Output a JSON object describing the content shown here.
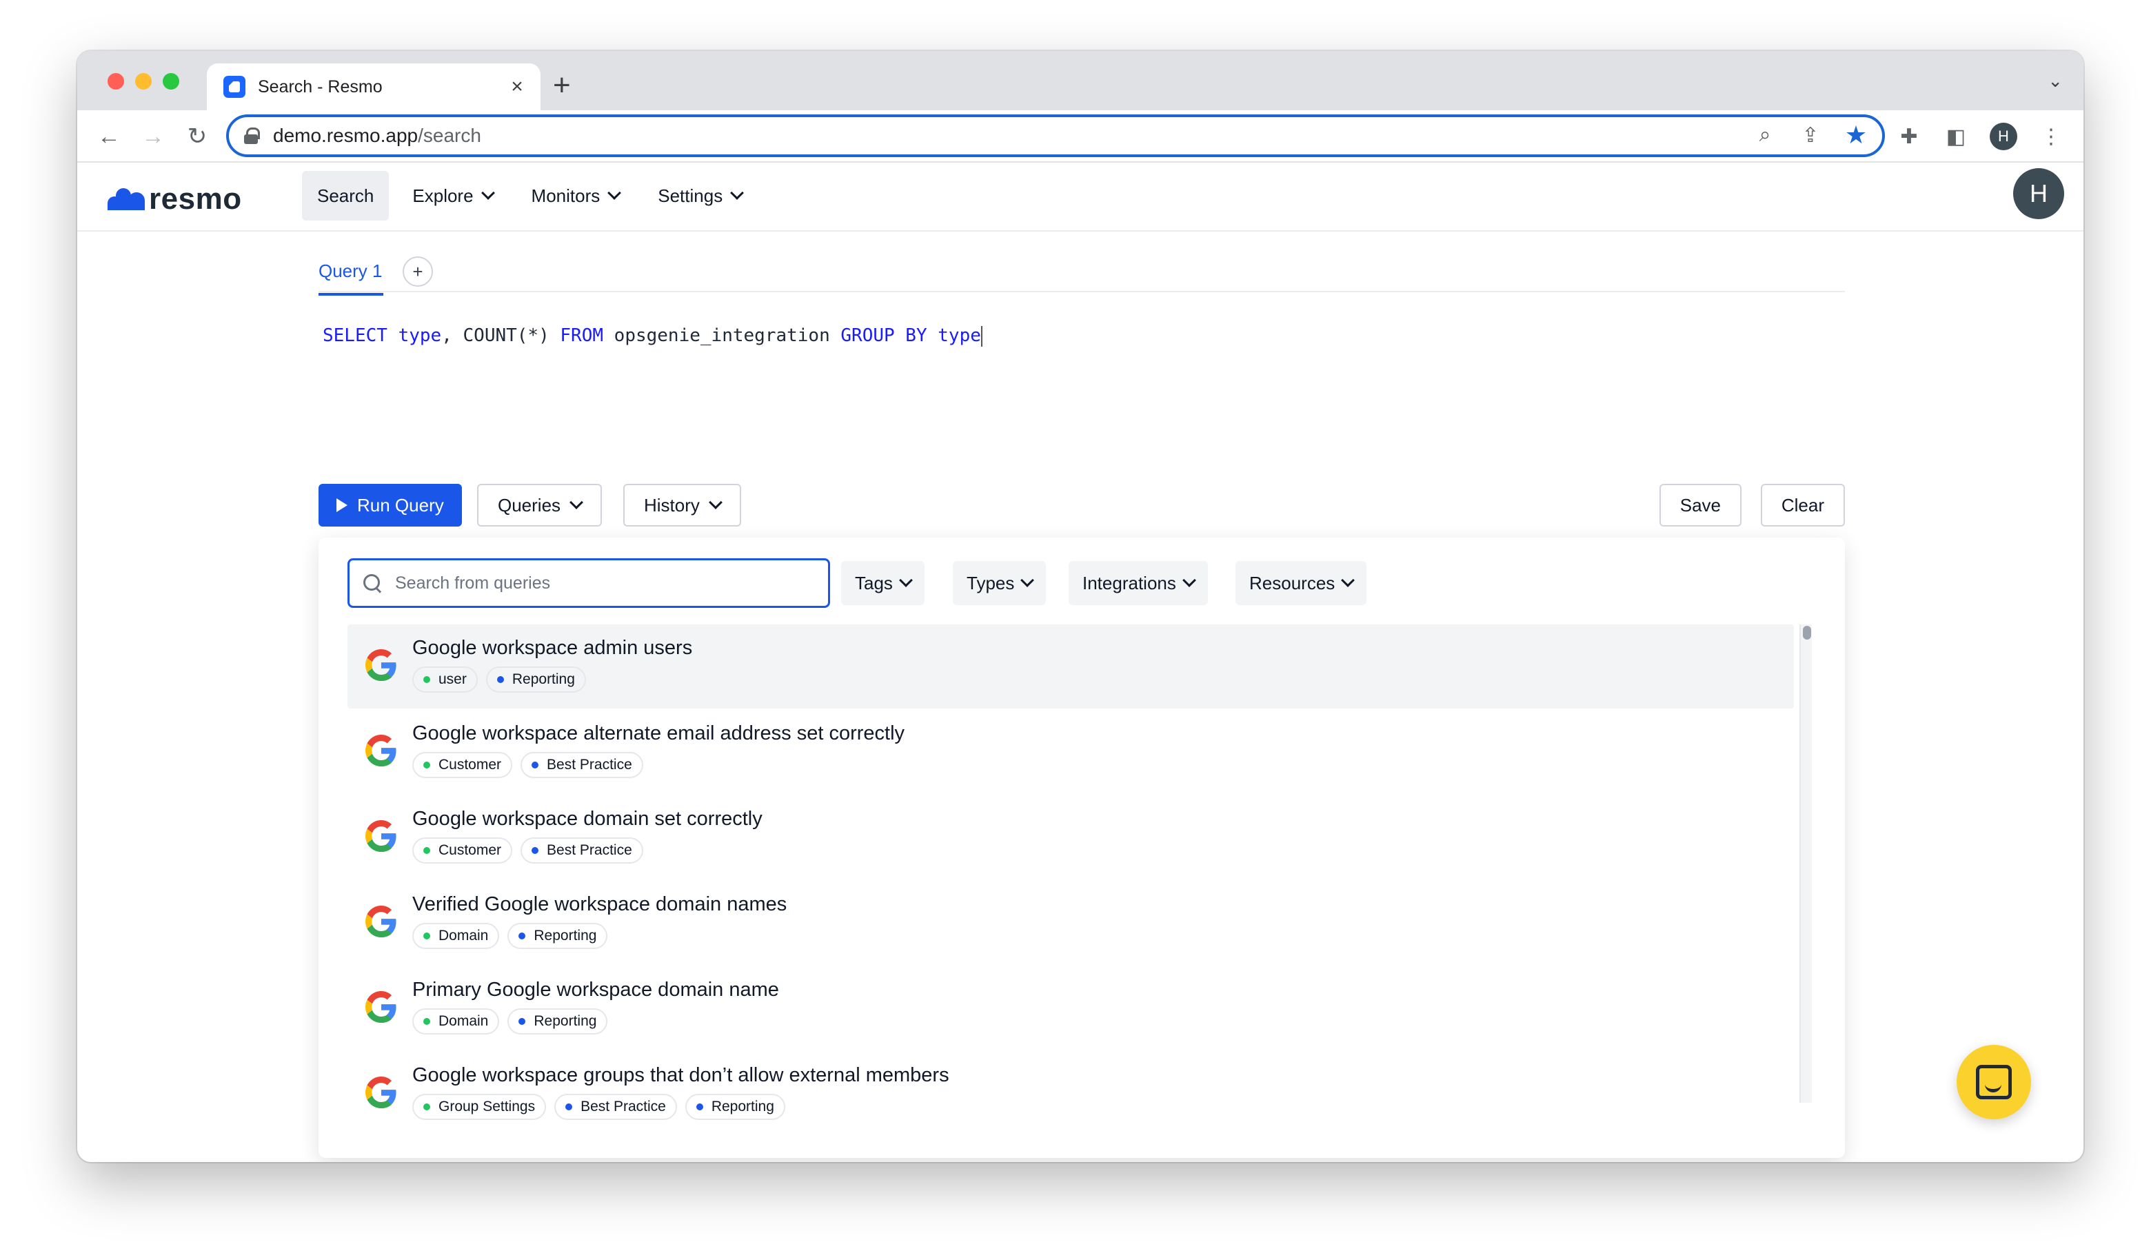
{
  "browser": {
    "tab_title": "Search - Resmo",
    "tab_close": "×",
    "new_tab": "+",
    "url_host": "demo.resmo.app",
    "url_path": "/search",
    "profile_initial": "H"
  },
  "app": {
    "logo_text": "resmo",
    "nav": [
      {
        "label": "Search"
      },
      {
        "label": "Explore"
      },
      {
        "label": "Monitors"
      },
      {
        "label": "Settings"
      }
    ],
    "user_initial": "H"
  },
  "query": {
    "tab_label": "Query 1",
    "add_tab": "+",
    "sql_tokens": [
      "SELECT",
      " ",
      "type",
      ", COUNT(*) ",
      "FROM",
      " opsgenie_integration ",
      "GROUP BY",
      " ",
      "type"
    ]
  },
  "buttons": {
    "run": "Run Query",
    "queries": "Queries",
    "history": "History",
    "save": "Save",
    "clear": "Clear"
  },
  "panel": {
    "search_placeholder": "Search from queries",
    "filters": [
      "Tags",
      "Types",
      "Integrations",
      "Resources"
    ],
    "items": [
      {
        "title": "Google workspace admin users",
        "tags": [
          "user",
          "Reporting"
        ]
      },
      {
        "title": "Google workspace alternate email address set correctly",
        "tags": [
          "Customer",
          "Best Practice"
        ]
      },
      {
        "title": "Google workspace domain set correctly",
        "tags": [
          "Customer",
          "Best Practice"
        ]
      },
      {
        "title": "Verified Google workspace domain names",
        "tags": [
          "Domain",
          "Reporting"
        ]
      },
      {
        "title": "Primary Google workspace domain name",
        "tags": [
          "Domain",
          "Reporting"
        ]
      },
      {
        "title": "Google workspace groups that don’t allow external members",
        "tags": [
          "Group Settings",
          "Best Practice",
          "Reporting"
        ]
      }
    ]
  },
  "colors": {
    "accent": "#1a56e8",
    "chat": "#fbd12e"
  }
}
